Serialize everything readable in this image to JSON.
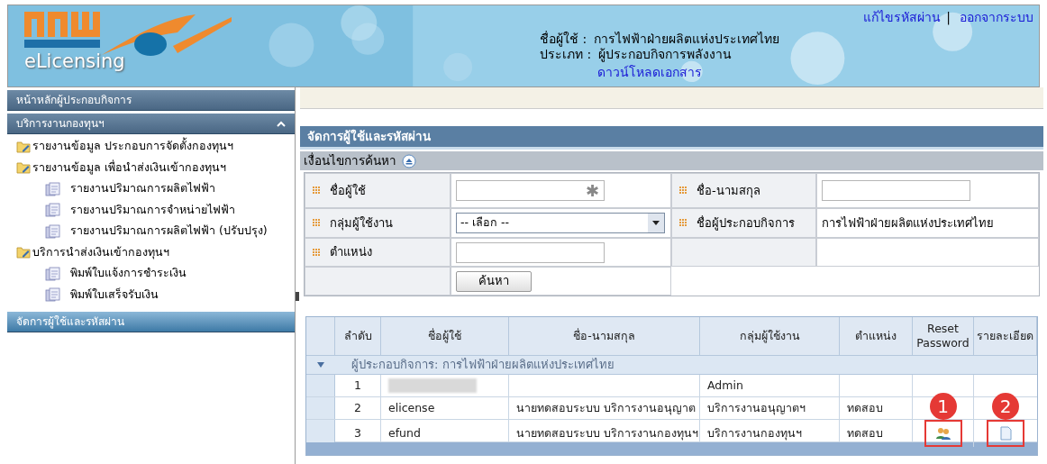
{
  "header": {
    "app_name": "eLicensing",
    "links": [
      "แก้ไขรหัสผ่าน",
      "ออกจากระบบ"
    ],
    "separator": "|",
    "user_label": "ชื่อผู้ใช้ :",
    "user_value": "การไฟฟ้าฝ่ายผลิตแห่งประเทศไทย",
    "type_label": "ประเภท :",
    "type_value": "ผู้ประกอบกิจการพลังงาน",
    "download_link": "ดาวน์โหลดเอกสาร"
  },
  "sidebar": {
    "sections": [
      {
        "title": "หน้าหลักผู้ประกอบกิจการ",
        "kind": "plain",
        "expanded": false
      },
      {
        "title": "บริการงานกองทุนฯ",
        "kind": "plain",
        "expanded": true,
        "children": [
          {
            "label": "รายงานข้อมูล ประกอบการจัดตั้งกองทุนฯ",
            "kind": "folder"
          },
          {
            "label": "รายงานข้อมูล เพื่อนำส่งเงินเข้ากองทุนฯ",
            "kind": "folder",
            "children": [
              {
                "label": "รายงานปริมาณการผลิตไฟฟ้า",
                "kind": "page"
              },
              {
                "label": "รายงานปริมาณการจำหน่ายไฟฟ้า",
                "kind": "page"
              },
              {
                "label": "รายงานปริมาณการผลิตไฟฟ้า (ปรับปรุง)",
                "kind": "page"
              }
            ]
          },
          {
            "label": "บริการนำส่งเงินเข้ากองทุนฯ",
            "kind": "folder",
            "children": [
              {
                "label": "พิมพ์ใบแจ้งการชำระเงิน",
                "kind": "page"
              },
              {
                "label": "พิมพ์ใบเสร็จรับเงิน",
                "kind": "page"
              }
            ]
          }
        ]
      },
      {
        "title": "จัดการผู้ใช้และรหัสผ่าน",
        "kind": "active",
        "expanded": false
      }
    ]
  },
  "panel": {
    "title": "จัดการผู้ใช้และรหัสผ่าน",
    "search_title": "เงื่อนไขการค้นหา",
    "fields": [
      {
        "label": "ชื่อผู้ใช้",
        "kind": "input",
        "marker": "✱"
      },
      {
        "label": "ชื่อ-นามสกุล",
        "kind": "input"
      },
      {
        "label": "กลุ่มผู้ใช้งาน",
        "kind": "select",
        "value": "-- เลือก --"
      },
      {
        "label": "ชื่อผู้ประกอบกิจการ",
        "kind": "text",
        "value": "การไฟฟ้าฝ่ายผลิตแห่งประเทศไทย"
      },
      {
        "label": "ตำแหน่ง",
        "kind": "input"
      }
    ],
    "search_button": "ค้นหา"
  },
  "table": {
    "columns": [
      "ลำดับ",
      "ชื่อผู้ใช้",
      "ชื่อ-นามสกุล",
      "กลุ่มผู้ใช้งาน",
      "ตำแหน่ง",
      "Reset Password",
      "รายละเอียด"
    ],
    "group": {
      "label": "ผู้ประกอบกิจการ: การไฟฟ้าฝ่ายผลิตแห่งประเทศไทย",
      "expanded": true
    },
    "rows": [
      {
        "no": "1",
        "redacted": true,
        "group": "Admin",
        "reset_icon": false,
        "detail_icon": false
      },
      {
        "no": "2",
        "username": "elicense",
        "redacted": false,
        "fullname": "นายทดสอบระบบ บริการงานอนุญาต",
        "group": "บริการงานอนุญาตฯ",
        "position": "ทดสอบ",
        "reset_icon": false,
        "detail_icon": false
      },
      {
        "no": "3",
        "username": "efund",
        "redacted": false,
        "fullname": "นายทดสอบระบบ บริการงานกองทุนฯ",
        "group": "บริการงานกองทุนฯ",
        "position": "ทดสอบ",
        "reset_icon": true,
        "detail_icon": true
      }
    ]
  },
  "annotations": [
    "1",
    "2"
  ]
}
